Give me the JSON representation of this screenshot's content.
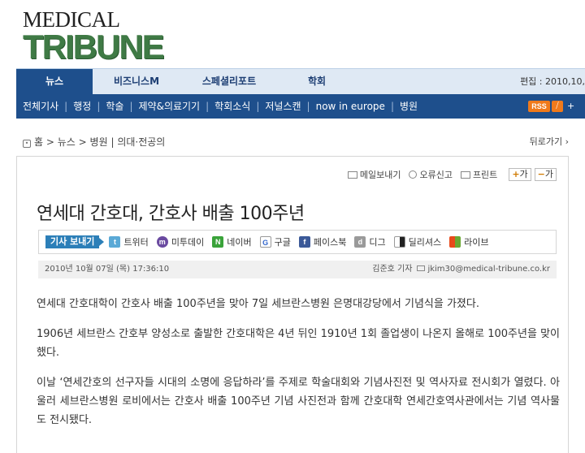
{
  "logo": {
    "line1": "MEDICAL",
    "line2": "TRIBUNE"
  },
  "nav": {
    "tabs": [
      {
        "label": "뉴스",
        "active": true
      },
      {
        "label": "비즈니스M",
        "active": false
      },
      {
        "label": "스페셜리포트",
        "active": false
      },
      {
        "label": "학회",
        "active": false
      }
    ],
    "edition_text": "편집 : 2010,10,"
  },
  "subnav": {
    "items": [
      "전체기사",
      "행정",
      "학술",
      "제약&의료기기",
      "학회소식",
      "저널스캔",
      "now in europe",
      "병원"
    ],
    "rss_label": "RSS",
    "more": "+"
  },
  "breadcrumb": {
    "home": "홈",
    "path": [
      "뉴스",
      "병원",
      "의대·전공의"
    ],
    "back_label": "뒤로가기"
  },
  "tools": {
    "email": "메일보내기",
    "report": "오류신고",
    "print": "프린트",
    "zoom_in": "가",
    "zoom_out": "가"
  },
  "article": {
    "title": "연세대 간호대, 간호사 배출 100주년",
    "date": "2010년 10월 07일 (목) 17:36:10",
    "author": "김준호 기자",
    "email": "jkim30@medical-tribune.co.kr",
    "paragraphs": [
      "연세대 간호대학이 간호사 배출 100주년을 맞아 7일 세브란스병원 은명대강당에서 기념식을 가졌다.",
      "1906년 세브란스 간호부 양성소로 출발한 간호대학은 4년 뒤인 1910년 1회 졸업생이 나온지 올해로 100주년을 맞이했다.",
      "이날 ‘연세간호의 선구자들 시대의 소명에 응답하라’를 주제로 학술대회와 기념사진전 및 역사자료 전시회가 열렸다. 아울러 세브란스병원 로비에서는 간호사 배출 100주년 기념 사진전과 함께 간호대학 연세간호역사관에서는 기념 역사물도 전시됐다."
    ]
  },
  "share": {
    "button": "기사 보내기",
    "services": [
      {
        "label": "트위터",
        "icon": "twitter-icon",
        "color": "#5aa9d6"
      },
      {
        "label": "미투데이",
        "icon": "me2day-icon",
        "color": "#6a4aa0"
      },
      {
        "label": "네이버",
        "icon": "naver-icon",
        "color": "#3aa33a"
      },
      {
        "label": "구글",
        "icon": "google-icon",
        "color": "#ffffff"
      },
      {
        "label": "페이스북",
        "icon": "facebook-icon",
        "color": "#3b5998"
      },
      {
        "label": "디그",
        "icon": "digg-icon",
        "color": "#9a9a9a"
      },
      {
        "label": "딜리셔스",
        "icon": "delicious-icon",
        "color": "#222222"
      },
      {
        "label": "라이브",
        "icon": "windows-live-icon",
        "color": "#e8a020"
      }
    ]
  },
  "colors": {
    "nav_blue": "#1e4f8c",
    "logo_green": "#3f7a45",
    "rss_orange": "#f07a1b"
  }
}
